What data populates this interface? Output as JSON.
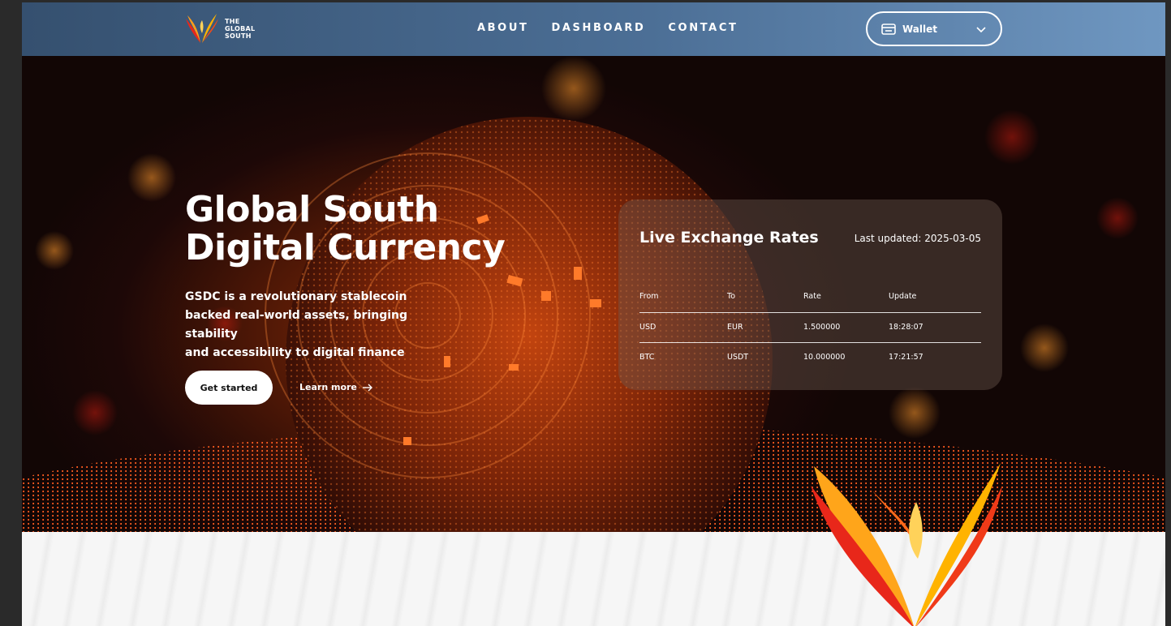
{
  "header": {
    "logo": {
      "line1": "THE",
      "line2": "GLOBAL",
      "line3": "SOUTH",
      "icon": "flame-wings-logo"
    },
    "nav": [
      {
        "label": "ABOUT"
      },
      {
        "label": "DASHBOARD"
      },
      {
        "label": "CONTACT"
      }
    ],
    "wallet": {
      "label": "Wallet",
      "icon": "wallet-icon",
      "chevron": "chevron-down-icon"
    }
  },
  "hero": {
    "title_line1": "Global South",
    "title_line2": "Digital Currency",
    "subtitle_line1": "GSDC is a revolutionary stablecoin",
    "subtitle_line2": "backed real-world assets, bringing stability",
    "subtitle_line3": "and accessibility to digital finance",
    "primary_button": "Get started",
    "secondary_link": "Learn more",
    "secondary_icon": "arrow-right-icon"
  },
  "rates": {
    "title": "Live Exchange Rates",
    "last_updated": "Last updated: 2025-03-05",
    "columns": [
      "From",
      "To",
      "Rate",
      "Update"
    ],
    "rows": [
      [
        "USD",
        "EUR",
        "1.500000",
        "18:28:07"
      ],
      [
        "BTC",
        "USDT",
        "10.000000",
        "17:21:57"
      ]
    ]
  },
  "colors": {
    "header_start": "#35506f",
    "header_end": "#6f97c1",
    "accent_orange": "#ff6a1a",
    "flame_red": "#e8271a",
    "flame_yellow": "#ffb300"
  }
}
